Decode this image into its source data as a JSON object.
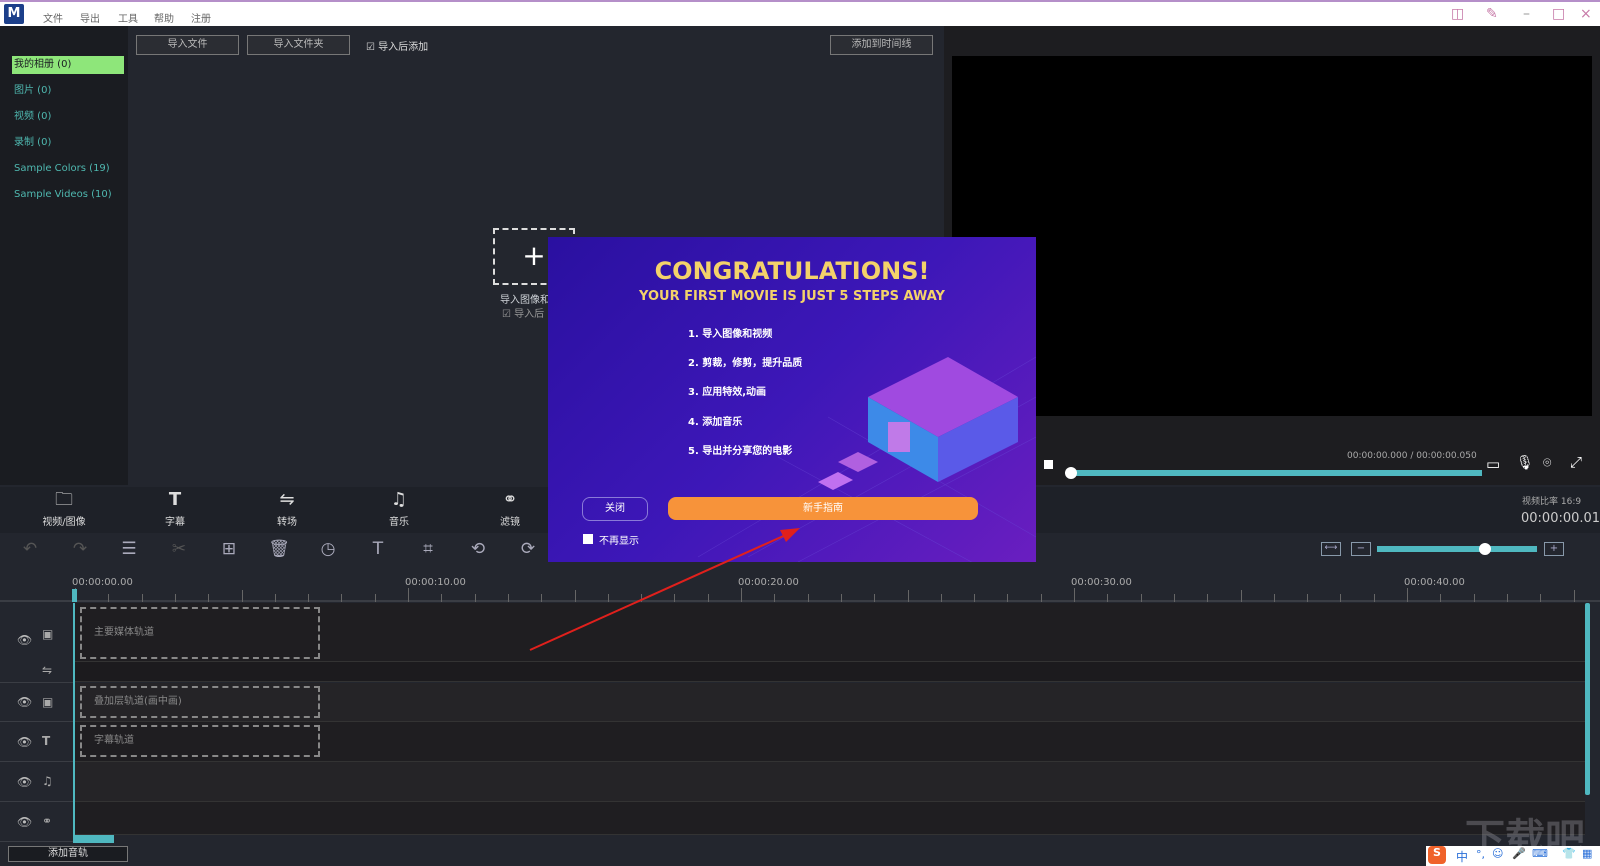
{
  "titlebar": {
    "logo": "M",
    "menu": [
      "文件",
      "导出",
      "工具",
      "帮助",
      "注册"
    ]
  },
  "sidebar": {
    "items": [
      "我的相册 (0)",
      "图片 (0)",
      "视频 (0)",
      "录制 (0)",
      "Sample Colors (19)",
      "Sample Videos (10)"
    ]
  },
  "media": {
    "import_file": "导入文件",
    "import_folder": "导入文件夹",
    "add_after_import": "导入后添加",
    "add_to_timeline": "添加到时间线",
    "placeholder_text": "导入图像和",
    "placeholder_check": "导入后"
  },
  "preview": {
    "time": "00:00:00.000 / 00:00:00.050",
    "aspect": "视频比率 16:9",
    "current": "00:00:00.01",
    "progress": 0.0,
    "zoom": 0.7
  },
  "tabs": [
    "视频/图像",
    "字幕",
    "转场",
    "音乐",
    "滤镜"
  ],
  "ruler": [
    "00:00:00.00",
    "00:00:10.00",
    "00:00:20.00",
    "00:00:30.00",
    "00:00:40.00"
  ],
  "tracks": {
    "main": "主要媒体轨道",
    "overlay": "叠加层轨道(画中画)",
    "subtitle": "字幕轨道"
  },
  "add_track": "添加音轨",
  "dialog": {
    "title": "CONGRATULATIONS!",
    "subtitle": "YOUR FIRST MOVIE IS JUST 5 STEPS AWAY",
    "steps": [
      "1. 导入图像和视频",
      "2. 剪裁，修剪，提升品质",
      "3. 应用特效,动画",
      "4. 添加音乐",
      "5. 导出并分享您的电影"
    ],
    "close": "关闭",
    "guide": "新手指南",
    "dont_show": "不再显示"
  },
  "watermark": "下载吧",
  "ime": [
    "S",
    "中",
    "°,",
    "☺",
    "🎤",
    "⌨",
    "👕",
    "▦"
  ]
}
